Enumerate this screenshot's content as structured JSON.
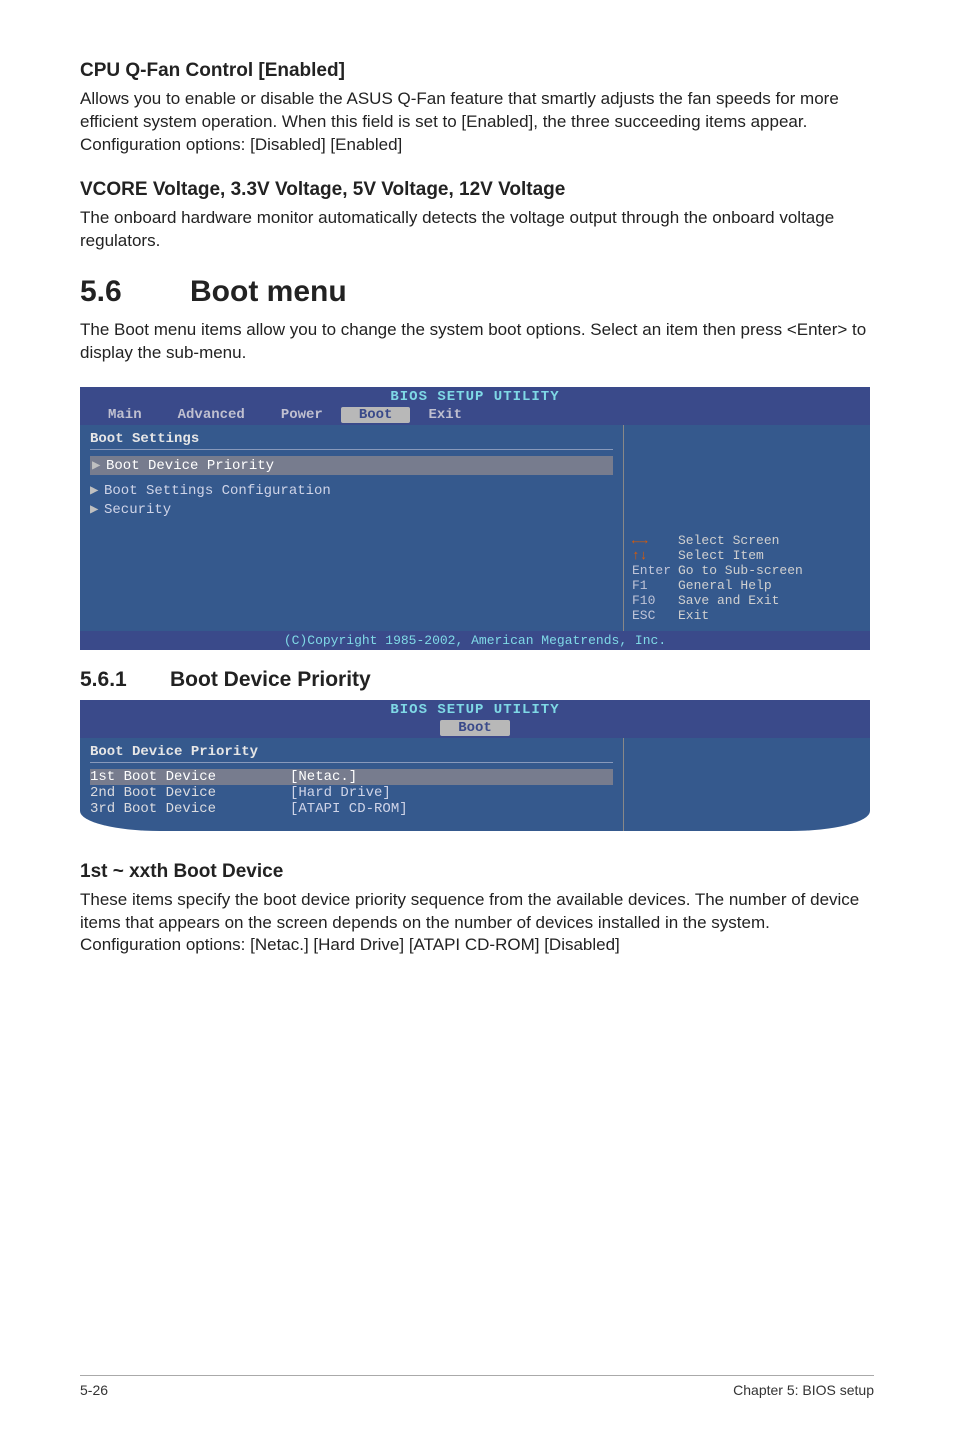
{
  "section_cpu": {
    "heading": "CPU Q-Fan Control [Enabled]",
    "text": "Allows you to enable or disable the ASUS Q-Fan feature that smartly adjusts the fan speeds for more efficient system operation. When this field is set to [Enabled], the three succeeding items appear. Configuration options: [Disabled] [Enabled]"
  },
  "section_vcore": {
    "heading": "VCORE Voltage, 3.3V Voltage, 5V Voltage, 12V Voltage",
    "text": "The onboard hardware monitor automatically detects the voltage output through the onboard voltage regulators."
  },
  "section_boot": {
    "num": "5.6",
    "title": "Boot menu",
    "intro": "The Boot menu items allow you to change the system boot options. Select an item then press <Enter> to display the sub-menu."
  },
  "bios1": {
    "title": "BIOS SETUP UTILITY",
    "tabs": [
      "Main",
      "Advanced",
      "Power",
      "Boot",
      "Exit"
    ],
    "active_tab": "Boot",
    "panel_title": "Boot Settings",
    "items": [
      {
        "label": "Boot Device Priority",
        "selected": true,
        "arrow": true
      },
      {
        "label": "Boot Settings Configuration",
        "selected": false,
        "arrow": true
      },
      {
        "label": "Security",
        "selected": false,
        "arrow": true
      }
    ],
    "help": [
      {
        "key": "←→",
        "text": "Select Screen"
      },
      {
        "key": "↑↓",
        "text": "Select Item"
      },
      {
        "key": "Enter",
        "text": "Go to Sub-screen"
      },
      {
        "key": "F1",
        "text": "General Help"
      },
      {
        "key": "F10",
        "text": "Save and Exit"
      },
      {
        "key": "ESC",
        "text": "Exit"
      }
    ],
    "copyright": "(C)Copyright 1985-2002, American Megatrends, Inc."
  },
  "subsection_561": {
    "num": "5.6.1",
    "title": "Boot Device Priority"
  },
  "bios2": {
    "title": "BIOS SETUP UTILITY",
    "active_tab": "Boot",
    "panel_title": "Boot Device Priority",
    "rows": [
      {
        "label": "1st Boot Device",
        "value": "[Netac.]",
        "selected": true
      },
      {
        "label": "2nd Boot Device",
        "value": "[Hard Drive]",
        "selected": false
      },
      {
        "label": "3rd Boot Device",
        "value": "[ATAPI CD-ROM]",
        "selected": false
      }
    ]
  },
  "section_1st": {
    "heading": "1st ~ xxth Boot Device",
    "text": "These items specify the boot device priority sequence from the available devices. The number of device items that appears on the screen depends on the number of devices installed in the system. Configuration options: [Netac.] [Hard Drive] [ATAPI CD-ROM] [Disabled]"
  },
  "footer": {
    "left": "5-26",
    "right": "Chapter 5: BIOS setup"
  }
}
